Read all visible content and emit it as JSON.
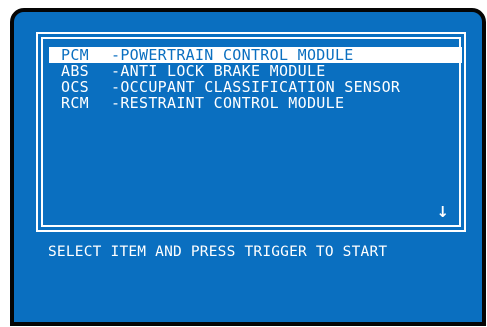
{
  "screen": {
    "background_color": "#0a6fc0",
    "text_color": "#ffffff",
    "border_color": "#050505"
  },
  "menu": {
    "selected_index": 0,
    "items": [
      {
        "code": "PCM",
        "description": "-POWERTRAIN CONTROL MODULE"
      },
      {
        "code": "ABS",
        "description": "-ANTI LOCK BRAKE MODULE"
      },
      {
        "code": "OCS",
        "description": "-OCCUPANT CLASSIFICATION SENSOR"
      },
      {
        "code": "RCM",
        "description": "-RESTRAINT CONTROL MODULE"
      }
    ],
    "scroll_indicator": "↓",
    "scroll_icon": "down-arrow-icon"
  },
  "prompt": {
    "text": "SELECT ITEM AND PRESS TRIGGER TO START"
  }
}
